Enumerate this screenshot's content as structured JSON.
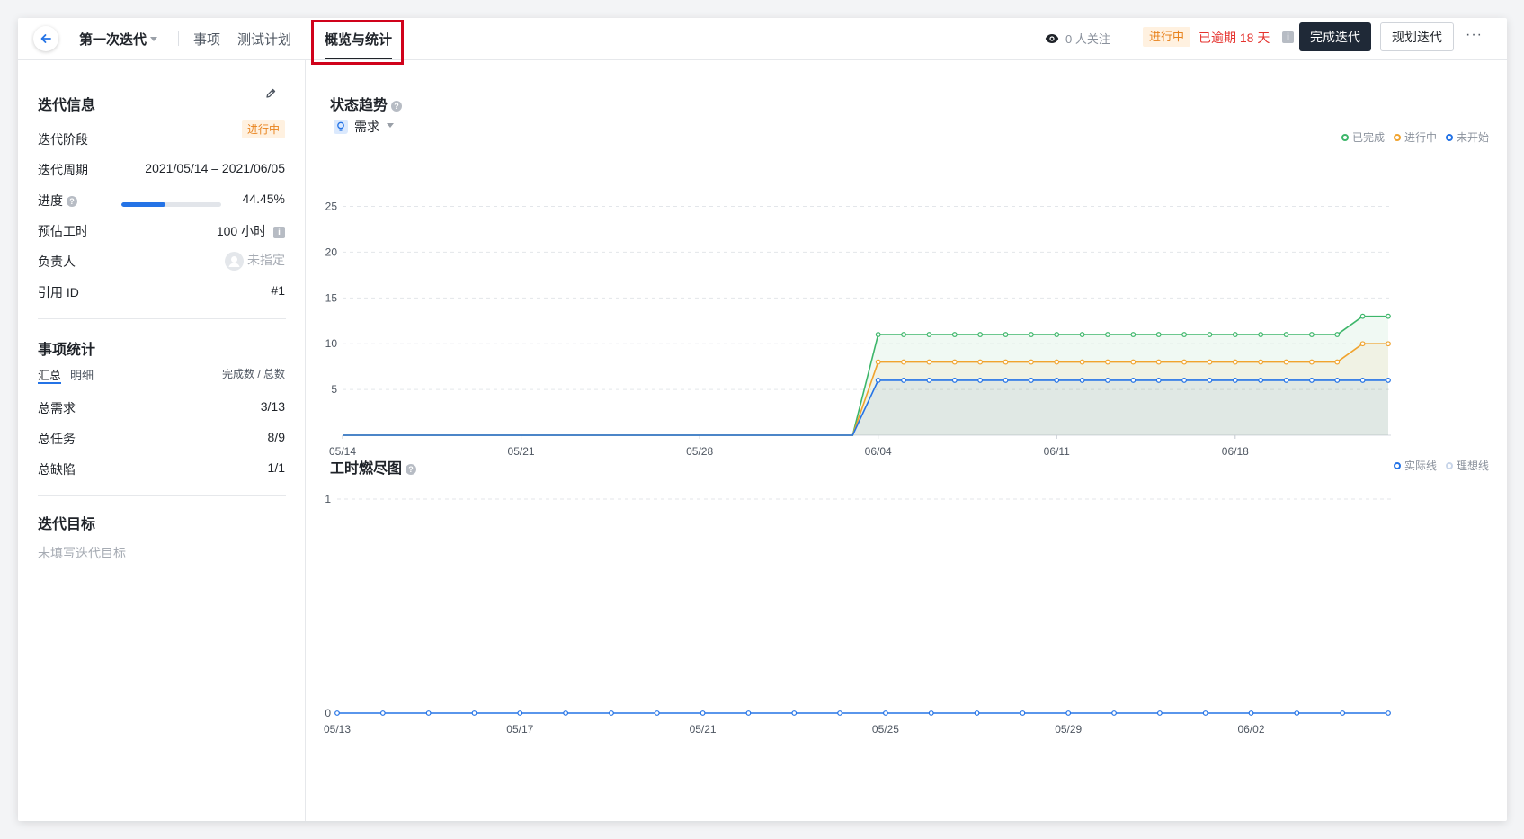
{
  "header": {
    "iteration_title": "第一次迭代",
    "tabs": [
      {
        "label": "事项"
      },
      {
        "label": "测试计划"
      },
      {
        "label": "概览与统计"
      }
    ],
    "watchers": "0 人关注",
    "status": "进行中",
    "overdue": "已逾期 18 天",
    "complete_button": "完成迭代",
    "plan_button": "规划迭代",
    "more": "···"
  },
  "sidebar": {
    "info_title": "迭代信息",
    "phase_label": "迭代阶段",
    "phase_value": "进行中",
    "period_label": "迭代周期",
    "period_value": "2021/05/14 – 2021/06/05",
    "progress_label": "进度",
    "progress_value": "44.45%",
    "progress_fraction": 0.4445,
    "estimate_label": "预估工时",
    "estimate_value": "100 小时",
    "owner_label": "负责人",
    "owner_value": "未指定",
    "ref_label": "引用 ID",
    "ref_value": "#1",
    "stats_title": "事项统计",
    "stats_tabs": [
      "汇总",
      "明细"
    ],
    "stats_header": "完成数 / 总数",
    "stats_rows": [
      {
        "label": "总需求",
        "value": "3/13"
      },
      {
        "label": "总任务",
        "value": "8/9"
      },
      {
        "label": "总缺陷",
        "value": "1/1"
      }
    ],
    "goal_title": "迭代目标",
    "goal_placeholder": "未填写迭代目标"
  },
  "main": {
    "trend_title": "状态趋势",
    "filter_label": "需求",
    "burndown_title": "工时燃尽图"
  },
  "colors": {
    "done": "#3db66a",
    "in_progress": "#f0a32e",
    "not_started": "#2473e6",
    "accent_dark": "#1f2937",
    "overdue_red": "#e5322d"
  },
  "chart_data": [
    {
      "type": "area",
      "title": "状态趋势",
      "x_tick_labels": [
        "05/14",
        "05/21",
        "05/28",
        "06/04",
        "06/11",
        "06/18"
      ],
      "y_ticks": [
        5,
        10,
        15,
        20,
        25
      ],
      "ylim": [
        0,
        25
      ],
      "grid": true,
      "legend_position": "top-right",
      "x": [
        "05/14",
        "05/15",
        "05/16",
        "05/17",
        "05/18",
        "05/19",
        "05/20",
        "05/21",
        "05/22",
        "05/23",
        "05/24",
        "05/25",
        "05/26",
        "05/27",
        "05/28",
        "05/29",
        "05/30",
        "05/31",
        "06/01",
        "06/02",
        "06/03",
        "06/04",
        "06/05",
        "06/06",
        "06/07",
        "06/08",
        "06/09",
        "06/10",
        "06/11",
        "06/12",
        "06/13",
        "06/14",
        "06/15",
        "06/16",
        "06/17",
        "06/18",
        "06/19",
        "06/20",
        "06/21",
        "06/22",
        "06/23",
        "06/24"
      ],
      "series": [
        {
          "name": "已完成",
          "color": "#3db66a",
          "values": [
            0,
            0,
            0,
            0,
            0,
            0,
            0,
            0,
            0,
            0,
            0,
            0,
            0,
            0,
            0,
            0,
            0,
            0,
            0,
            0,
            0,
            11,
            11,
            11,
            11,
            11,
            11,
            11,
            11,
            11,
            11,
            11,
            11,
            11,
            11,
            11,
            11,
            11,
            11,
            11,
            13,
            13
          ]
        },
        {
          "name": "进行中",
          "color": "#f0a32e",
          "values": [
            0,
            0,
            0,
            0,
            0,
            0,
            0,
            0,
            0,
            0,
            0,
            0,
            0,
            0,
            0,
            0,
            0,
            0,
            0,
            0,
            0,
            8,
            8,
            8,
            8,
            8,
            8,
            8,
            8,
            8,
            8,
            8,
            8,
            8,
            8,
            8,
            8,
            8,
            8,
            8,
            10,
            10
          ]
        },
        {
          "name": "未开始",
          "color": "#2473e6",
          "values": [
            0,
            0,
            0,
            0,
            0,
            0,
            0,
            0,
            0,
            0,
            0,
            0,
            0,
            0,
            0,
            0,
            0,
            0,
            0,
            0,
            0,
            6,
            6,
            6,
            6,
            6,
            6,
            6,
            6,
            6,
            6,
            6,
            6,
            6,
            6,
            6,
            6,
            6,
            6,
            6,
            6,
            6
          ]
        }
      ]
    },
    {
      "type": "line",
      "title": "工时燃尽图",
      "x_tick_labels": [
        "05/13",
        "05/17",
        "05/21",
        "05/25",
        "05/29",
        "06/02"
      ],
      "y_ticks": [
        0,
        1
      ],
      "ylim": [
        0,
        1
      ],
      "grid": true,
      "legend_position": "top-right",
      "series": [
        {
          "name": "实际线",
          "color": "#2473e6",
          "values": [
            0,
            0,
            0,
            0,
            0,
            0,
            0,
            0,
            0,
            0,
            0,
            0,
            0,
            0,
            0,
            0,
            0,
            0,
            0,
            0,
            0,
            0,
            0,
            0
          ]
        },
        {
          "name": "理想线",
          "color": "#c9d6ea",
          "values": []
        }
      ]
    }
  ]
}
